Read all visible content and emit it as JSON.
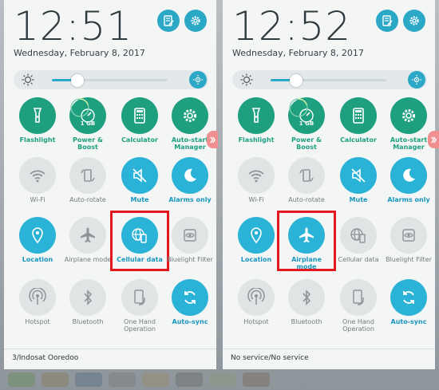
{
  "left": {
    "clock": "12:51",
    "date": "Wednesday, February 8, 2017",
    "brightness": 0.22,
    "status": "3/Indosat Ooredoo",
    "tiles": [
      {
        "label": "Flashlight",
        "icon": "flashlight-icon",
        "state": "green"
      },
      {
        "label": "Power & Boost",
        "icon": "gauge-icon",
        "state": "green",
        "badge": "1 GB"
      },
      {
        "label": "Calculator",
        "icon": "calculator-icon",
        "state": "green"
      },
      {
        "label": "Auto-start Manager",
        "icon": "gear-icon",
        "state": "green"
      },
      {
        "label": "Wi-Fi",
        "icon": "wifi-icon",
        "state": "gray"
      },
      {
        "label": "Auto-rotate",
        "icon": "rotate-icon",
        "state": "gray"
      },
      {
        "label": "Mute",
        "icon": "mute-icon",
        "state": "blue"
      },
      {
        "label": "Alarms only",
        "icon": "moon-icon",
        "state": "blue"
      },
      {
        "label": "Location",
        "icon": "location-icon",
        "state": "blue"
      },
      {
        "label": "Airplane mode",
        "icon": "airplane-icon",
        "state": "gray"
      },
      {
        "label": "Cellular data",
        "icon": "cellular-data-icon",
        "state": "blue"
      },
      {
        "label": "Bluelight Filter",
        "icon": "eye-icon",
        "state": "gray"
      },
      {
        "label": "Hotspot",
        "icon": "hotspot-icon",
        "state": "gray"
      },
      {
        "label": "Bluetooth",
        "icon": "bluetooth-icon",
        "state": "gray"
      },
      {
        "label": "One Hand Operation",
        "icon": "one-hand-icon",
        "state": "gray"
      },
      {
        "label": "Auto-sync",
        "icon": "sync-icon",
        "state": "blue"
      }
    ],
    "highlight_index": 10
  },
  "right": {
    "clock": "12:52",
    "date": "Wednesday, February 8, 2017",
    "brightness": 0.22,
    "status": "No service/No service",
    "tiles": [
      {
        "label": "Flashlight",
        "icon": "flashlight-icon",
        "state": "green"
      },
      {
        "label": "Power & Boost",
        "icon": "gauge-icon",
        "state": "green",
        "badge": "1 GB"
      },
      {
        "label": "Calculator",
        "icon": "calculator-icon",
        "state": "green"
      },
      {
        "label": "Auto-start Manager",
        "icon": "gear-icon",
        "state": "green"
      },
      {
        "label": "Wi-Fi",
        "icon": "wifi-icon",
        "state": "gray"
      },
      {
        "label": "Auto-rotate",
        "icon": "rotate-icon",
        "state": "gray"
      },
      {
        "label": "Mute",
        "icon": "mute-icon",
        "state": "blue"
      },
      {
        "label": "Alarms only",
        "icon": "moon-icon",
        "state": "blue"
      },
      {
        "label": "Location",
        "icon": "location-icon",
        "state": "blue"
      },
      {
        "label": "Airplane mode",
        "icon": "airplane-icon",
        "state": "blue"
      },
      {
        "label": "Cellular data",
        "icon": "cellular-data-icon",
        "state": "gray"
      },
      {
        "label": "Bluelight Filter",
        "icon": "eye-icon",
        "state": "gray"
      },
      {
        "label": "Hotspot",
        "icon": "hotspot-icon",
        "state": "gray"
      },
      {
        "label": "Bluetooth",
        "icon": "bluetooth-icon",
        "state": "gray"
      },
      {
        "label": "One Hand Operation",
        "icon": "one-hand-icon",
        "state": "gray"
      },
      {
        "label": "Auto-sync",
        "icon": "sync-icon",
        "state": "blue"
      }
    ],
    "highlight_index": 9
  },
  "colors": {
    "green": "#1ea07f",
    "blue": "#2ab3d6",
    "gray": "#e1e4e5",
    "highlight": "#e3181f"
  }
}
